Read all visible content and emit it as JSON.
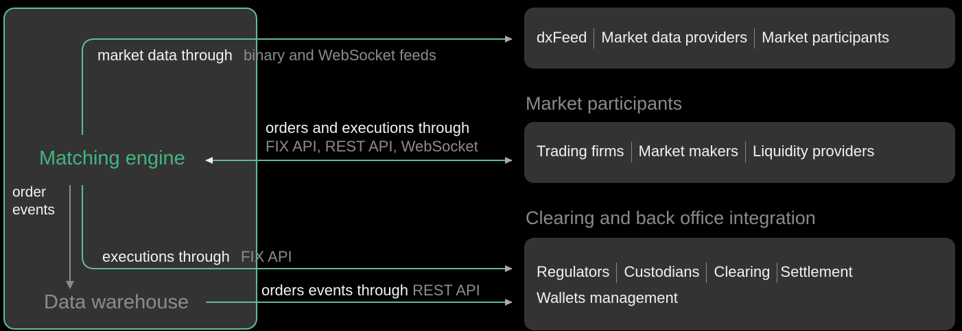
{
  "engine": {
    "matching_engine": "Matching engine",
    "data_warehouse": "Data warehouse",
    "order_events_line1": "order",
    "order_events_line2": "events"
  },
  "flows": {
    "market_data_white": "market data through",
    "market_data_grey": "binary and WebSocket feeds",
    "orders_white": "orders and executions through",
    "orders_grey": "FIX API, REST API, WebSocket",
    "executions_white": "executions through",
    "executions_grey": "FIX API",
    "order_events_white": "orders events through",
    "order_events_grey": "REST API"
  },
  "cards": {
    "market_data": {
      "items": [
        "dxFeed",
        "Market data providers",
        "Market participants"
      ]
    },
    "participants": {
      "title": "Market participants",
      "items": [
        "Trading firms",
        "Market makers",
        "Liquidity providers"
      ]
    },
    "clearing": {
      "title": "Clearing and back office integration",
      "items": [
        "Regulators",
        "Custodians",
        "Clearing",
        "Settlement"
      ],
      "line2": "Wallets management"
    }
  },
  "colors": {
    "accent": "#43b581",
    "line": "#5fbf94",
    "card_bg": "#333333",
    "muted": "#8c8c8c"
  }
}
